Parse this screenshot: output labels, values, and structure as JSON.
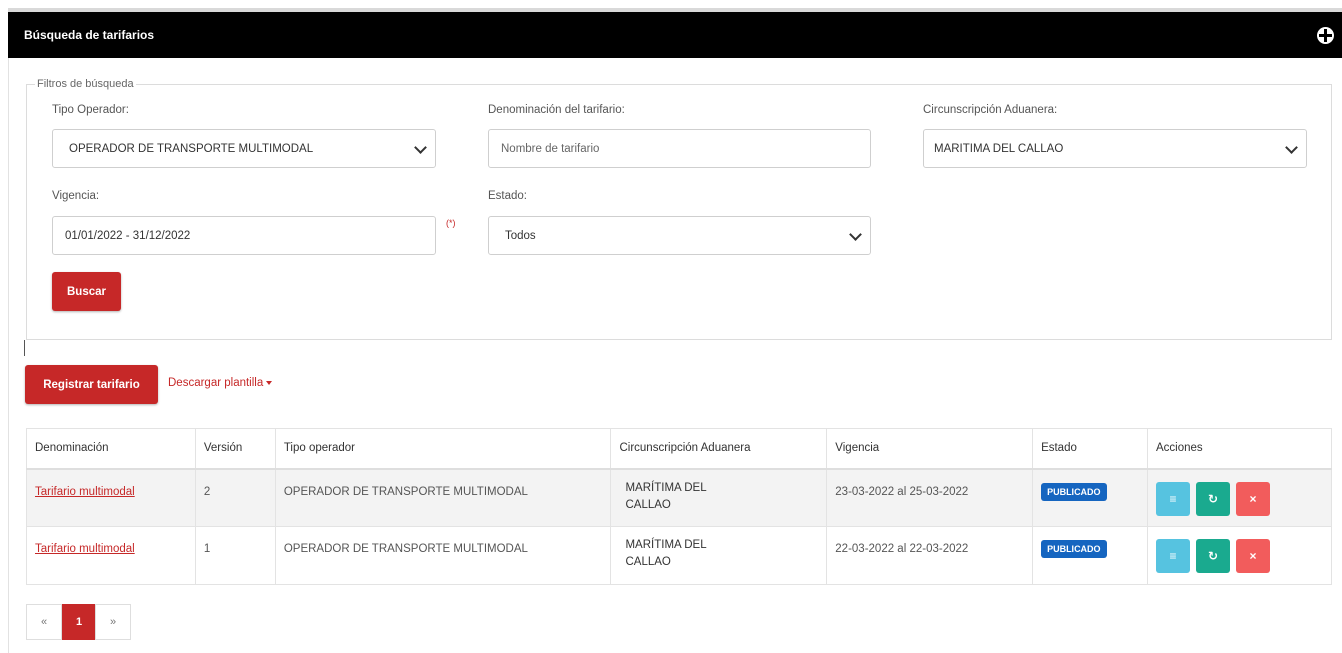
{
  "header": {
    "title": "Búsqueda de tarifarios",
    "icon": "globe-icon"
  },
  "filters": {
    "legend": "Filtros de búsqueda",
    "tipo_operador": {
      "label": "Tipo Operador:",
      "value": "OPERADOR DE TRANSPORTE MULTIMODAL"
    },
    "denominacion": {
      "label": "Denominación del tarifario:",
      "placeholder": "Nombre de tarifario"
    },
    "circunscripcion": {
      "label": "Circunscripción Aduanera:",
      "value": "MARITIMA DEL CALLAO"
    },
    "vigencia": {
      "label": "Vigencia:",
      "value": "01/01/2022 - 31/12/2022",
      "required_mark": "(*)"
    },
    "estado": {
      "label": "Estado:",
      "value": "Todos"
    },
    "search_button": "Buscar"
  },
  "actions": {
    "register_button": "Registrar tarifario",
    "download_link": "Descargar plantilla"
  },
  "table": {
    "headers": [
      "Denominación",
      "Versión",
      "Tipo operador",
      "Circunscripción Aduanera",
      "Vigencia",
      "Estado",
      "Acciones"
    ],
    "rows": [
      {
        "denominacion": "Tarifario multimodal",
        "version": "2",
        "tipo_operador": "OPERADOR DE TRANSPORTE MULTIMODAL",
        "circ_line1": "MARÍTIMA DEL",
        "circ_line2": "CALLAO",
        "vigencia": "23-03-2022 al 25-03-2022",
        "estado": "PUBLICADO"
      },
      {
        "denominacion": "Tarifario multimodal",
        "version": "1",
        "tipo_operador": "OPERADOR DE TRANSPORTE MULTIMODAL",
        "circ_line1": "MARÍTIMA DEL",
        "circ_line2": "CALLAO",
        "vigencia": "22-03-2022 al 22-03-2022",
        "estado": "PUBLICADO"
      }
    ],
    "action_icons": [
      "list-icon",
      "sync-icon",
      "delete-icon"
    ]
  },
  "pagination": {
    "prev": "«",
    "current": "1",
    "next": "»"
  },
  "colors": {
    "accent": "#c62828",
    "badge": "#1565c0",
    "header_bg": "#000000"
  }
}
